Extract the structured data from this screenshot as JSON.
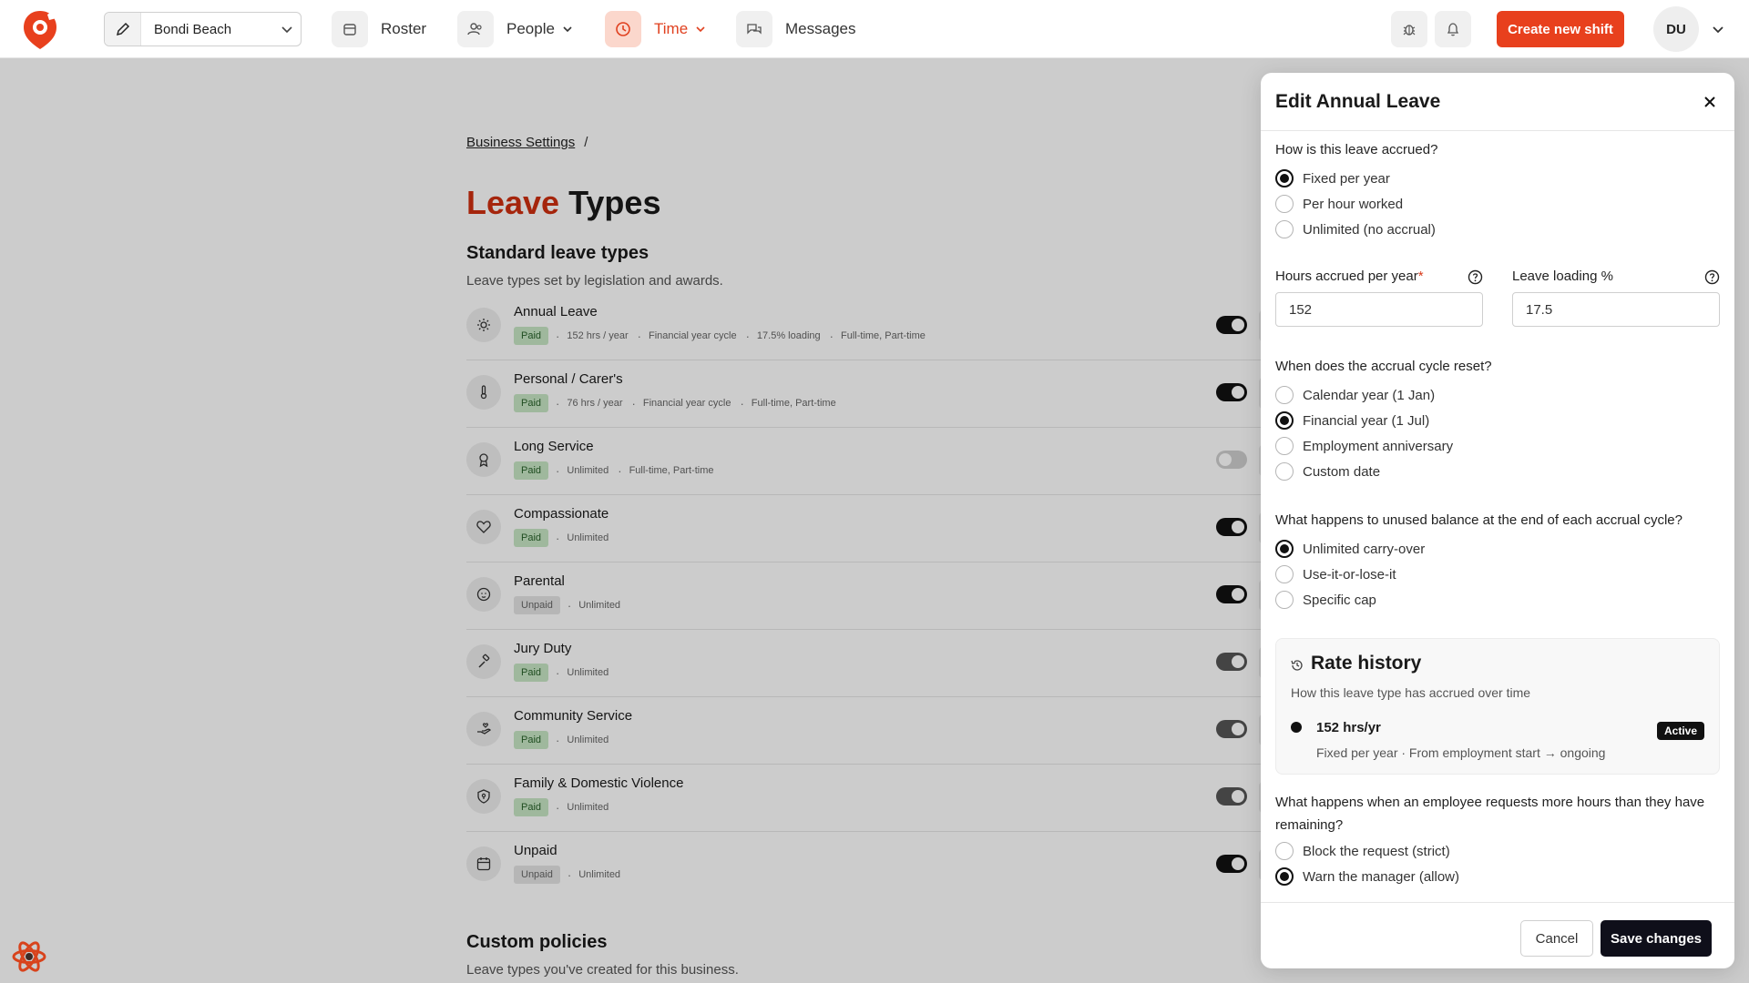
{
  "topbar": {
    "location": "Bondi Beach",
    "nav": {
      "roster": "Roster",
      "people": "People",
      "time": "Time",
      "messages": "Messages"
    },
    "create_button": "Create new shift",
    "avatar_initials": "DU",
    "accent_color": "#e8401d"
  },
  "page": {
    "breadcrumb": {
      "link": "Business Settings",
      "separator": "/"
    },
    "title_part1": "Leave",
    "title_part2": "Types",
    "standard": {
      "title": "Standard leave types",
      "subtitle": "Leave types set by legislation and awards.",
      "items": [
        {
          "name": "Annual Leave",
          "icon": "sun-icon",
          "badge": "Paid",
          "meta": [
            "152 hrs / year",
            "Financial year cycle",
            "17.5% loading",
            "Full-time, Part-time"
          ],
          "enabled": true
        },
        {
          "name": "Personal / Carer's",
          "icon": "thermometer-icon",
          "badge": "Paid",
          "meta": [
            "76 hrs / year",
            "Financial year cycle",
            "Full-time, Part-time"
          ],
          "enabled": true
        },
        {
          "name": "Long Service",
          "icon": "award-icon",
          "badge": "Paid",
          "meta": [
            "Unlimited",
            "Full-time, Part-time"
          ],
          "enabled": false
        },
        {
          "name": "Compassionate",
          "icon": "heart-icon",
          "badge": "Paid",
          "meta": [
            "Unlimited"
          ],
          "enabled": true
        },
        {
          "name": "Parental",
          "icon": "baby-icon",
          "badge": "Unpaid",
          "meta": [
            "Unlimited"
          ],
          "enabled": true
        },
        {
          "name": "Jury Duty",
          "icon": "gavel-icon",
          "badge": "Paid",
          "meta": [
            "Unlimited"
          ],
          "enabled": true
        },
        {
          "name": "Community Service",
          "icon": "hand-heart-icon",
          "badge": "Paid",
          "meta": [
            "Unlimited"
          ],
          "enabled": true
        },
        {
          "name": "Family & Domestic Violence",
          "icon": "shield-icon",
          "badge": "Paid",
          "meta": [
            "Unlimited"
          ],
          "enabled": true
        },
        {
          "name": "Unpaid",
          "icon": "calendar-icon",
          "badge": "Unpaid",
          "meta": [
            "Unlimited"
          ],
          "enabled": true
        }
      ]
    },
    "custom": {
      "title": "Custom policies",
      "subtitle": "Leave types you've created for this business."
    }
  },
  "drawer": {
    "title": "Edit Annual Leave",
    "accrual_question": "How is this leave accrued?",
    "accrual_options": [
      "Fixed per year",
      "Per hour worked",
      "Unlimited (no accrual)"
    ],
    "accrual_selected": 0,
    "hours_label": "Hours accrued per year",
    "hours_required_mark": "*",
    "hours_value": "152",
    "loading_label": "Leave loading %",
    "loading_value": "17.5",
    "reset_question": "When does the accrual cycle reset?",
    "reset_options": [
      "Calendar year (1 Jan)",
      "Financial year (1 Jul)",
      "Employment anniversary",
      "Custom date"
    ],
    "reset_selected": 1,
    "unused_question": "What happens to unused balance at the end of each accrual cycle?",
    "unused_options": [
      "Unlimited carry-over",
      "Use-it-or-lose-it",
      "Specific cap"
    ],
    "unused_selected": 0,
    "rate_history": {
      "title": "Rate history",
      "subtitle": "How this leave type has accrued over time",
      "entry_value": "152 hrs/yr",
      "entry_detail": "Fixed per year · From employment start → ongoing",
      "entry_badge": "Active"
    },
    "overdraw_question": "What happens when an employee requests more hours than they have remaining?",
    "overdraw_options": [
      "Block the request (strict)",
      "Warn the manager (allow)"
    ],
    "overdraw_selected": 1,
    "cancel_label": "Cancel",
    "save_label": "Save changes"
  }
}
